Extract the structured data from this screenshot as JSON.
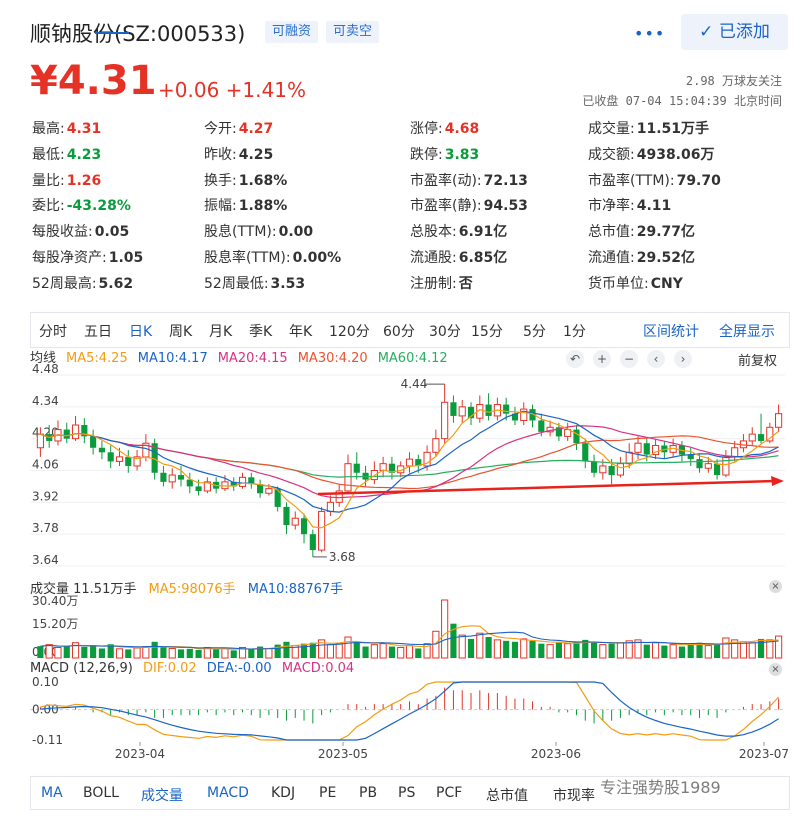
{
  "header": {
    "title": "顺钠股份(SZ:000533)",
    "tags": [
      "可融资",
      "可卖空"
    ],
    "more_icon": "more-dots-icon",
    "added_label": "已添加"
  },
  "quote": {
    "price": "¥4.31",
    "change": "+0.06",
    "change_pct": "+1.41%",
    "followers": "2.98 万球友关注",
    "status": "已收盘 07-04 15:04:39 北京时间"
  },
  "stats": [
    {
      "label": "最高:",
      "value": "4.31",
      "color": "red"
    },
    {
      "label": "今开:",
      "value": "4.27",
      "color": "red"
    },
    {
      "label": "涨停:",
      "value": "4.68",
      "color": "red"
    },
    {
      "label": "成交量:",
      "value": "11.51万手",
      "color": "plain"
    },
    {
      "label": "最低:",
      "value": "4.23",
      "color": "green"
    },
    {
      "label": "昨收:",
      "value": "4.25",
      "color": "plain"
    },
    {
      "label": "跌停:",
      "value": "3.83",
      "color": "green"
    },
    {
      "label": "成交额:",
      "value": "4938.06万",
      "color": "plain"
    },
    {
      "label": "量比:",
      "value": "1.26",
      "color": "red"
    },
    {
      "label": "换手:",
      "value": "1.68%",
      "color": "plain"
    },
    {
      "label": "市盈率(动):",
      "value": "72.13",
      "color": "plain"
    },
    {
      "label": "市盈率(TTM):",
      "value": "79.70",
      "color": "plain"
    },
    {
      "label": "委比:",
      "value": "-43.28%",
      "color": "green"
    },
    {
      "label": "振幅:",
      "value": "1.88%",
      "color": "plain"
    },
    {
      "label": "市盈率(静):",
      "value": "94.53",
      "color": "plain"
    },
    {
      "label": "市净率:",
      "value": "4.11",
      "color": "plain"
    },
    {
      "label": "每股收益:",
      "value": "0.05",
      "color": "plain"
    },
    {
      "label": "股息(TTM):",
      "value": "0.00",
      "color": "plain"
    },
    {
      "label": "总股本:",
      "value": "6.91亿",
      "color": "plain"
    },
    {
      "label": "总市值:",
      "value": "29.77亿",
      "color": "plain"
    },
    {
      "label": "每股净资产:",
      "value": "1.05",
      "color": "plain"
    },
    {
      "label": "股息率(TTM):",
      "value": "0.00%",
      "color": "plain"
    },
    {
      "label": "流通股:",
      "value": "6.85亿",
      "color": "plain"
    },
    {
      "label": "流通值:",
      "value": "29.52亿",
      "color": "plain"
    },
    {
      "label": "52周最高:",
      "value": "5.62",
      "color": "plain"
    },
    {
      "label": "52周最低:",
      "value": "3.53",
      "color": "plain"
    },
    {
      "label": "注册制:",
      "value": "否",
      "color": "plain"
    },
    {
      "label": "货币单位:",
      "value": "CNY",
      "color": "plain"
    }
  ],
  "periods": [
    "分时",
    "五日",
    "日K",
    "周K",
    "月K",
    "季K",
    "年K",
    "120分",
    "60分",
    "30分",
    "15分",
    "5分",
    "1分"
  ],
  "period_active": "日K",
  "period_links": [
    "区间统计",
    "全屏显示"
  ],
  "ma_legend": {
    "label": "均线",
    "items": [
      {
        "text": "MA5:4.25",
        "color": "#f39c12"
      },
      {
        "text": "MA10:4.17",
        "color": "#1a64c8"
      },
      {
        "text": "MA20:4.15",
        "color": "#d63384"
      },
      {
        "text": "MA30:4.20",
        "color": "#e8542f"
      },
      {
        "text": "MA60:4.12",
        "color": "#27ae60"
      }
    ]
  },
  "chart_tools": {
    "icons": [
      "undo-icon",
      "zoom-in-icon",
      "zoom-out-icon",
      "prev-icon",
      "next-icon"
    ],
    "adjust": "前复权"
  },
  "price_axis": [
    "4.48",
    "4.34",
    "4.20",
    "4.06",
    "3.92",
    "3.78",
    "3.64"
  ],
  "annotations": {
    "high": "4.44",
    "low": "3.68"
  },
  "volume_legend": {
    "label": "成交量 11.51万手",
    "ma5": "MA5:98076手",
    "ma10": "MA10:88767手"
  },
  "volume_axis": [
    "30.40万",
    "15.20万",
    "0.00"
  ],
  "macd_legend": {
    "label": "MACD (12,26,9)",
    "dif": "DIF:0.02",
    "dea": "DEA:-0.00",
    "macd": "MACD:0.04"
  },
  "macd_axis": [
    "0.10",
    "0.00",
    "-0.11"
  ],
  "dates": [
    "2023-04",
    "2023-05",
    "2023-06",
    "2023-07"
  ],
  "indicators": [
    "MA",
    "BOLL",
    "成交量",
    "MACD",
    "KDJ",
    "PE",
    "PB",
    "PS",
    "PCF",
    "总市值",
    "市现率"
  ],
  "watermark": "专注强势股1989",
  "colors": {
    "up": "#e43326",
    "down": "#0a9b3c",
    "accent": "#1a64c8"
  },
  "chart_data": {
    "type": "candlestick",
    "ylim": [
      3.64,
      4.48
    ],
    "candles": [
      [
        4.16,
        4.22,
        4.25,
        4.12
      ],
      [
        4.22,
        4.19,
        4.26,
        4.16
      ],
      [
        4.19,
        4.24,
        4.28,
        4.17
      ],
      [
        4.24,
        4.2,
        4.27,
        4.18
      ],
      [
        4.2,
        4.26,
        4.3,
        4.19
      ],
      [
        4.26,
        4.21,
        4.29,
        4.18
      ],
      [
        4.21,
        4.16,
        4.24,
        4.13
      ],
      [
        4.16,
        4.14,
        4.19,
        4.11
      ],
      [
        4.14,
        4.1,
        4.17,
        4.07
      ],
      [
        4.1,
        4.12,
        4.16,
        4.08
      ],
      [
        4.12,
        4.08,
        4.15,
        4.05
      ],
      [
        4.08,
        4.12,
        4.15,
        4.06
      ],
      [
        4.12,
        4.18,
        4.22,
        4.1
      ],
      [
        4.18,
        4.05,
        4.2,
        4.02
      ],
      [
        4.05,
        4.01,
        4.08,
        3.99
      ],
      [
        4.01,
        4.04,
        4.07,
        3.98
      ],
      [
        4.04,
        4.02,
        4.08,
        3.99
      ],
      [
        4.02,
        3.99,
        4.05,
        3.96
      ],
      [
        3.99,
        3.97,
        4.02,
        3.95
      ],
      [
        3.97,
        4.01,
        4.03,
        3.96
      ],
      [
        4.01,
        3.98,
        4.03,
        3.96
      ],
      [
        3.98,
        4.01,
        4.04,
        3.97
      ],
      [
        4.01,
        3.99,
        4.03,
        3.97
      ],
      [
        3.99,
        4.03,
        4.05,
        3.98
      ],
      [
        4.03,
        4.0,
        4.05,
        3.98
      ],
      [
        4.0,
        3.96,
        4.02,
        3.94
      ],
      [
        3.96,
        3.98,
        4.0,
        3.95
      ],
      [
        3.98,
        3.9,
        3.99,
        3.88
      ],
      [
        3.9,
        3.82,
        3.92,
        3.78
      ],
      [
        3.82,
        3.85,
        3.88,
        3.8
      ],
      [
        3.85,
        3.78,
        3.87,
        3.74
      ],
      [
        3.78,
        3.71,
        3.8,
        3.68
      ],
      [
        3.71,
        3.88,
        3.9,
        3.7
      ],
      [
        3.88,
        3.92,
        3.95,
        3.86
      ],
      [
        3.92,
        3.97,
        4.0,
        3.9
      ],
      [
        3.97,
        4.09,
        4.13,
        3.96
      ],
      [
        4.09,
        4.05,
        4.14,
        4.02
      ],
      [
        4.05,
        4.02,
        4.08,
        3.99
      ],
      [
        4.02,
        4.06,
        4.1,
        4.0
      ],
      [
        4.06,
        4.09,
        4.12,
        4.03
      ],
      [
        4.09,
        4.05,
        4.12,
        4.02
      ],
      [
        4.05,
        4.08,
        4.1,
        4.03
      ],
      [
        4.08,
        4.11,
        4.14,
        4.05
      ],
      [
        4.11,
        4.08,
        4.13,
        4.05
      ],
      [
        4.08,
        4.14,
        4.17,
        4.06
      ],
      [
        4.14,
        4.2,
        4.24,
        4.12
      ],
      [
        4.2,
        4.36,
        4.44,
        4.18
      ],
      [
        4.36,
        4.3,
        4.39,
        4.27
      ],
      [
        4.3,
        4.34,
        4.37,
        4.27
      ],
      [
        4.34,
        4.29,
        4.36,
        4.26
      ],
      [
        4.29,
        4.35,
        4.39,
        4.27
      ],
      [
        4.35,
        4.3,
        4.4,
        4.28
      ],
      [
        4.3,
        4.35,
        4.38,
        4.28
      ],
      [
        4.35,
        4.31,
        4.38,
        4.28
      ],
      [
        4.31,
        4.28,
        4.34,
        4.26
      ],
      [
        4.28,
        4.33,
        4.36,
        4.26
      ],
      [
        4.33,
        4.28,
        4.35,
        4.25
      ],
      [
        4.28,
        4.23,
        4.31,
        4.21
      ],
      [
        4.23,
        4.25,
        4.28,
        4.21
      ],
      [
        4.25,
        4.21,
        4.27,
        4.19
      ],
      [
        4.21,
        4.24,
        4.27,
        4.19
      ],
      [
        4.24,
        4.18,
        4.26,
        4.15
      ],
      [
        4.18,
        4.1,
        4.2,
        4.07
      ],
      [
        4.1,
        4.05,
        4.13,
        4.03
      ],
      [
        4.05,
        4.08,
        4.11,
        4.02
      ],
      [
        4.08,
        4.04,
        4.11,
        4.0
      ],
      [
        4.04,
        4.09,
        4.12,
        4.03
      ],
      [
        4.09,
        4.14,
        4.18,
        4.07
      ],
      [
        4.14,
        4.18,
        4.21,
        4.11
      ],
      [
        4.18,
        4.13,
        4.2,
        4.1
      ],
      [
        4.13,
        4.17,
        4.2,
        4.11
      ],
      [
        4.17,
        4.14,
        4.19,
        4.11
      ],
      [
        4.14,
        4.17,
        4.2,
        4.12
      ],
      [
        4.17,
        4.13,
        4.19,
        4.1
      ],
      [
        4.13,
        4.11,
        4.16,
        4.08
      ],
      [
        4.11,
        4.07,
        4.13,
        4.05
      ],
      [
        4.07,
        4.09,
        4.12,
        4.05
      ],
      [
        4.09,
        4.04,
        4.11,
        4.02
      ],
      [
        4.04,
        4.12,
        4.15,
        4.03
      ],
      [
        4.12,
        4.16,
        4.19,
        4.1
      ],
      [
        4.16,
        4.19,
        4.22,
        4.14
      ],
      [
        4.19,
        4.22,
        4.25,
        4.17
      ],
      [
        4.22,
        4.19,
        4.31,
        4.18
      ],
      [
        4.19,
        4.25,
        4.27,
        4.18
      ],
      [
        4.25,
        4.31,
        4.35,
        4.23
      ]
    ],
    "volume_ylim": [
      0,
      304000
    ],
    "volumes": [
      [
        62,
        "d"
      ],
      [
        70,
        "u"
      ],
      [
        55,
        "u"
      ],
      [
        60,
        "d"
      ],
      [
        80,
        "u"
      ],
      [
        58,
        "d"
      ],
      [
        65,
        "d"
      ],
      [
        50,
        "d"
      ],
      [
        72,
        "d"
      ],
      [
        48,
        "u"
      ],
      [
        45,
        "d"
      ],
      [
        52,
        "u"
      ],
      [
        60,
        "u"
      ],
      [
        85,
        "d"
      ],
      [
        55,
        "d"
      ],
      [
        50,
        "u"
      ],
      [
        45,
        "d"
      ],
      [
        48,
        "d"
      ],
      [
        42,
        "d"
      ],
      [
        55,
        "u"
      ],
      [
        45,
        "d"
      ],
      [
        48,
        "u"
      ],
      [
        40,
        "d"
      ],
      [
        55,
        "u"
      ],
      [
        45,
        "d"
      ],
      [
        60,
        "d"
      ],
      [
        50,
        "u"
      ],
      [
        70,
        "d"
      ],
      [
        85,
        "d"
      ],
      [
        65,
        "u"
      ],
      [
        75,
        "d"
      ],
      [
        80,
        "d"
      ],
      [
        95,
        "u"
      ],
      [
        70,
        "u"
      ],
      [
        75,
        "u"
      ],
      [
        110,
        "u"
      ],
      [
        85,
        "d"
      ],
      [
        60,
        "d"
      ],
      [
        70,
        "u"
      ],
      [
        75,
        "u"
      ],
      [
        60,
        "d"
      ],
      [
        55,
        "u"
      ],
      [
        65,
        "u"
      ],
      [
        50,
        "d"
      ],
      [
        75,
        "u"
      ],
      [
        140,
        "u"
      ],
      [
        304,
        "u"
      ],
      [
        180,
        "d"
      ],
      [
        120,
        "u"
      ],
      [
        100,
        "d"
      ],
      [
        130,
        "u"
      ],
      [
        110,
        "d"
      ],
      [
        95,
        "u"
      ],
      [
        90,
        "d"
      ],
      [
        85,
        "d"
      ],
      [
        100,
        "u"
      ],
      [
        90,
        "d"
      ],
      [
        75,
        "d"
      ],
      [
        70,
        "u"
      ],
      [
        80,
        "d"
      ],
      [
        75,
        "u"
      ],
      [
        85,
        "d"
      ],
      [
        95,
        "d"
      ],
      [
        80,
        "d"
      ],
      [
        70,
        "u"
      ],
      [
        75,
        "d"
      ],
      [
        80,
        "u"
      ],
      [
        90,
        "u"
      ],
      [
        95,
        "u"
      ],
      [
        70,
        "d"
      ],
      [
        80,
        "u"
      ],
      [
        65,
        "d"
      ],
      [
        70,
        "u"
      ],
      [
        60,
        "d"
      ],
      [
        75,
        "d"
      ],
      [
        80,
        "d"
      ],
      [
        65,
        "u"
      ],
      [
        70,
        "d"
      ],
      [
        105,
        "u"
      ],
      [
        95,
        "u"
      ],
      [
        85,
        "u"
      ],
      [
        80,
        "u"
      ],
      [
        100,
        "d"
      ],
      [
        95,
        "u"
      ],
      [
        115,
        "u"
      ]
    ],
    "macd_ylim": [
      -0.11,
      0.1
    ],
    "macd_hist": [
      0.01,
      0.01,
      0.0,
      0.0,
      0.01,
      0.0,
      -0.01,
      -0.01,
      -0.02,
      -0.01,
      -0.02,
      -0.02,
      -0.01,
      -0.03,
      -0.03,
      -0.02,
      -0.02,
      -0.02,
      -0.02,
      -0.01,
      -0.02,
      -0.01,
      -0.02,
      -0.01,
      -0.02,
      -0.03,
      -0.02,
      -0.03,
      -0.04,
      -0.03,
      -0.04,
      -0.05,
      -0.02,
      -0.01,
      0.0,
      0.02,
      0.02,
      0.01,
      0.02,
      0.02,
      0.02,
      0.02,
      0.03,
      0.02,
      0.04,
      0.05,
      0.08,
      0.07,
      0.07,
      0.06,
      0.07,
      0.06,
      0.06,
      0.05,
      0.04,
      0.04,
      0.03,
      0.01,
      0.01,
      -0.01,
      -0.01,
      -0.02,
      -0.04,
      -0.05,
      -0.04,
      -0.04,
      -0.03,
      -0.02,
      -0.01,
      -0.02,
      -0.01,
      -0.02,
      -0.01,
      -0.02,
      -0.02,
      -0.03,
      -0.02,
      -0.03,
      -0.01,
      0.0,
      0.01,
      0.02,
      0.02,
      0.03,
      0.04
    ]
  }
}
